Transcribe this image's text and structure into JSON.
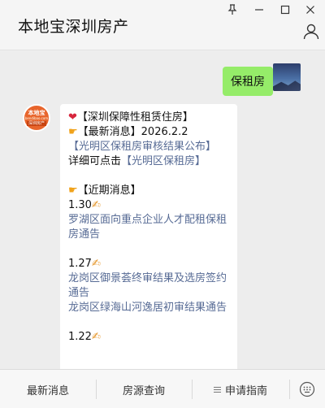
{
  "header": {
    "title": "本地宝深圳房产",
    "window_controls": [
      "pin-icon",
      "minimize-icon",
      "maximize-icon",
      "close-icon"
    ],
    "user_icon": "user-icon"
  },
  "chat": {
    "outgoing": {
      "text": "保租房"
    },
    "incoming": {
      "avatar": {
        "brand": "本地宝",
        "sub": "bendibao.com",
        "tag": "深圳房产"
      },
      "heading": "【深圳保障性租赁住房】",
      "latest_label": "【最新消息】2026.2.2",
      "latest_link": "【光明区保租房审核结果公布】",
      "detail_prefix": "详细可点击",
      "detail_link": "【光明区保租房】",
      "recent_label": "【近期消息】",
      "items": [
        {
          "date": "1.30",
          "links": [
            "罗湖区面向重点企业人才配租保租房通告"
          ]
        },
        {
          "date": "1.27",
          "links": [
            "龙岗区御景荟终审结果及选房签约通告",
            "龙岗区绿海山河逸居初审结果通告"
          ]
        },
        {
          "date": "1.22",
          "links": []
        }
      ]
    }
  },
  "menu": {
    "items": [
      "最新消息",
      "房源查询",
      "申请指南"
    ],
    "keyboard_icon": "keyboard-icon"
  },
  "colors": {
    "bubble_out": "#95ec69",
    "link": "#576b95",
    "background": "#ededed"
  }
}
